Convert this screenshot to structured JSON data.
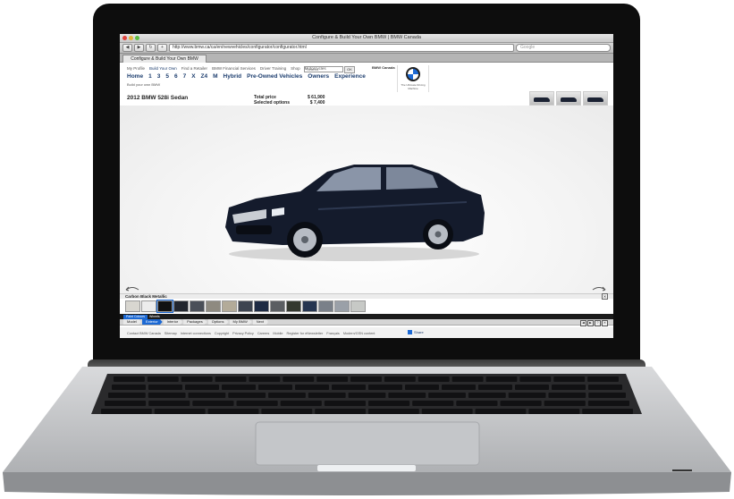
{
  "browser": {
    "window_title": "Configure & Build Your Own BMW | BMW Canada",
    "url": "http://www.bmw.ca/ca/en/newvehicles/configurator/configurator.html",
    "search_placeholder": "Google",
    "tab_title": "Configure & Build Your Own BMW",
    "back_glyph": "◀",
    "forward_glyph": "▶",
    "reload_glyph": "↻",
    "add_glyph": "+"
  },
  "site": {
    "top_nav": [
      "My Profile",
      "Build Your Own",
      "Find a Retailer",
      "BMW Financial Services",
      "Driver Training",
      "Shop",
      "Motorcycles"
    ],
    "search_placeholder": "Search",
    "go_label": "OK",
    "models": [
      "Home",
      "1",
      "3",
      "5",
      "6",
      "7",
      "X",
      "Z4",
      "M",
      "Hybrid",
      "Pre-Owned Vehicles",
      "Owners",
      "Experience"
    ],
    "build_label": "Build your own BMW",
    "region_label": "BMW Canada",
    "logo_tagline": "The Ultimate Driving Machine",
    "vehicle_title": "2012 BMW 528i Sedan",
    "total_price_label": "Total price",
    "total_price_value": "$ 61,900",
    "selected_options_label": "Selected options",
    "selected_options_value": "$ 7,400",
    "color_name": "Carbon Black Metallic",
    "close_glyph": "✕",
    "swatches": [
      "#d8d6d0",
      "#ededed",
      "#111111",
      "#22262e",
      "#4a4f58",
      "#8e8a80",
      "#b3ab99",
      "#3d4450",
      "#1e2b44",
      "#5b5e62",
      "#34382f",
      "#263550",
      "#7a8089",
      "#9aa0a8",
      "#c7c9c6"
    ],
    "selected_swatch_index": 2,
    "sub_tabs": [
      "Paint Colours",
      "Wheels"
    ],
    "steps": [
      "Model",
      "Exterior",
      "Interior",
      "Packages",
      "Options",
      "My BMW",
      "Next"
    ],
    "active_step_index": 1,
    "step_tools": [
      "◀",
      "▶",
      "?",
      "✕"
    ],
    "footer_links": [
      "Contact BMW Canada",
      "Sitemap",
      "Internet connections",
      "Copyright",
      "Privacy Policy",
      "Careers",
      "Mobile",
      "Register for eNewsletter",
      "Français",
      "Modern/GSN content"
    ],
    "share_label": "Share"
  },
  "colors": {
    "bmw_blue": "#1c69d4",
    "nav_blue": "#1c3d6e",
    "car_paint": "#141b2c"
  }
}
